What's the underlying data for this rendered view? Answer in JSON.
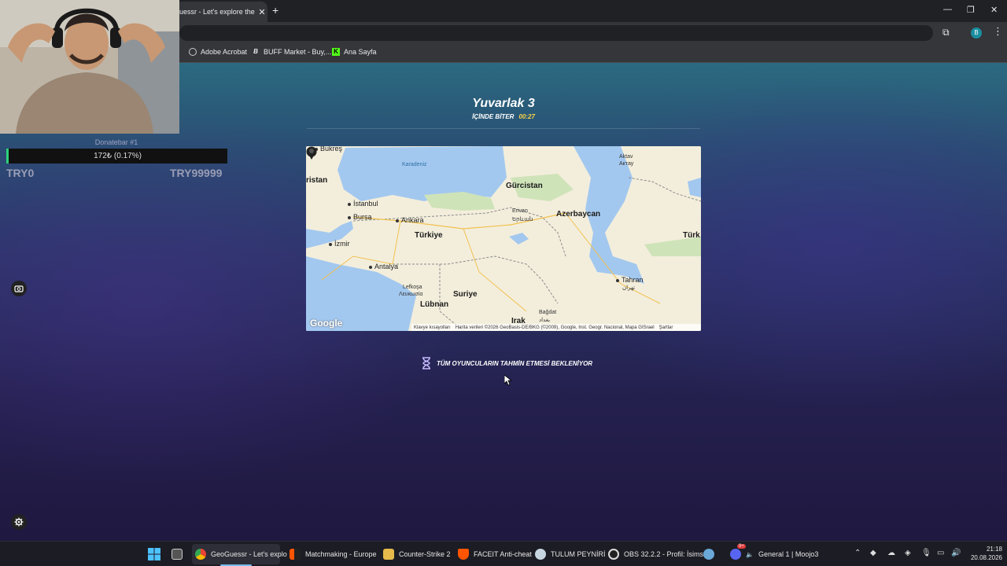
{
  "browser": {
    "tab_title": "uessr - Let's explore the w",
    "profile_initial": "B",
    "bookmarks": [
      {
        "label": "Adobe Acrobat"
      },
      {
        "label": "BUFF Market - Buy,..."
      },
      {
        "label": "Ana Sayfa"
      }
    ]
  },
  "game": {
    "round_title": "Yuvarlak 3",
    "ends_in_label": "İÇİNDE BİTER",
    "timer": "00:27",
    "waiting_text": "TÜM OYUNCULARIN TAHMİN ETMESİ BEKLENİYOR"
  },
  "map": {
    "labels": {
      "bukres": "Bukreş",
      "karadeniz": "Karadeniz",
      "aktav": "Aktav",
      "aktav_native": "Актау",
      "ristan": "ristan",
      "gurcistan": "Gürcistan",
      "istanbul": "İstanbul",
      "bursa": "Bursa",
      "ankara": "Ankara",
      "erivan": "Erivan",
      "erivan_native": "Երևան",
      "azerbaycan": "Azerbaycan",
      "turkiye": "Türkiye",
      "turk": "Türk",
      "izmir": "İzmir",
      "antalya": "Antalya",
      "tahran": "Tahran",
      "tahran_native": "تهران",
      "lefkosa": "Lefkoşa",
      "lefkosa_native": "Λευκωσία",
      "suriye": "Suriye",
      "lubnan": "Lübnan",
      "bagdat": "Bağdat",
      "bagdat_native": "بغداد",
      "irak": "Irak"
    },
    "google": "Google",
    "attribution": {
      "shortcuts": "Klavye kısayolları",
      "data": "Harita verileri ©2026 GeoBasis-DE/BKG (©2009), Google, Inst. Geogr. Nacional, Mapa GISrael",
      "terms": "Şartlar"
    }
  },
  "overlay": {
    "donate_title": "Donatebar #1",
    "donate_value": "172₺ (0.17%)",
    "donate_progress": 0.17,
    "donate_min": "TRY0",
    "donate_max": "TRY99999"
  },
  "taskbar": {
    "items": [
      {
        "label": "GeoGuessr - Let's explo"
      },
      {
        "label": "Matchmaking - Europe"
      },
      {
        "label": "Counter-Strike 2"
      },
      {
        "label": "FACEIT Anti-cheat"
      },
      {
        "label": "TULUM PEYNİRİ"
      },
      {
        "label": "OBS 32.2.2 - Profil: İsims"
      },
      {
        "label": "General 1 | Moojo3"
      }
    ],
    "discord_badge": "9+",
    "time": "21:18",
    "date": "20.08.2026"
  },
  "colors": {
    "timer": "#f8d247",
    "donate_accent": "#2fd17a",
    "sea": "#a3c8ef",
    "land": "#f3eedc"
  },
  "icons": [
    "hourglass-icon",
    "map-pin-icon",
    "gear-icon",
    "camera-swap-icon",
    "windows-icon",
    "chrome-icon"
  ]
}
